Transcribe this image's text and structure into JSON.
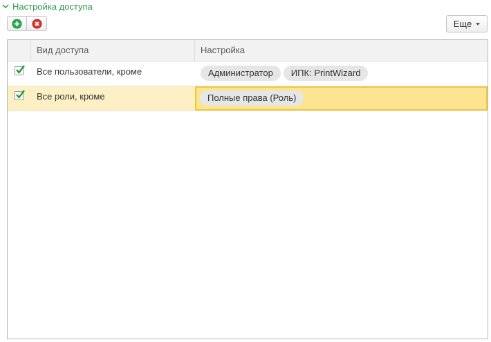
{
  "group": {
    "title": "Настройка доступа"
  },
  "toolbar": {
    "add_icon": "add-icon",
    "delete_icon": "delete-icon",
    "more_label": "Еще"
  },
  "table": {
    "headers": [
      "",
      "Вид доступа",
      "Настройка"
    ],
    "rows": [
      {
        "checked": true,
        "access_kind": "Все пользователи, кроме",
        "settings": [
          "Администратор",
          "ИПК: PrintWizard"
        ],
        "selected": false
      },
      {
        "checked": true,
        "access_kind": "Все роли, кроме",
        "settings": [
          "Полные права (Роль)"
        ],
        "selected": true
      }
    ]
  },
  "colors": {
    "group_title": "#2a9a4a",
    "add": "#2fa84f",
    "delete": "#d9342b",
    "selected_row": "#fcf0c4",
    "selected_cell": "#fde490",
    "selected_border": "#f0c840",
    "check": "#1f9a3a"
  }
}
